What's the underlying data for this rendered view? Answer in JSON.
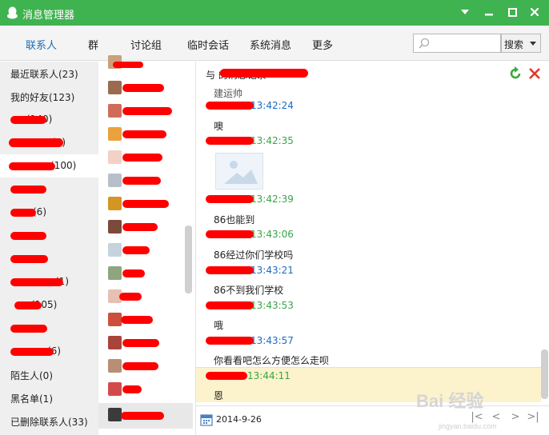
{
  "titlebar": {
    "title": "消息管理器"
  },
  "tabs": [
    {
      "label": "联系人",
      "active": true
    },
    {
      "label": "群"
    },
    {
      "label": "讨论组"
    },
    {
      "label": "临时会话"
    },
    {
      "label": "系统消息"
    },
    {
      "label": "更多"
    }
  ],
  "search": {
    "placeholder": "",
    "button_label": "搜索"
  },
  "categories": [
    {
      "label": "最近联系人(23)"
    },
    {
      "label": "我的好友(123)"
    },
    {
      "label": "(140)"
    },
    {
      "label": "(5)"
    },
    {
      "label": "(100)",
      "selected": true
    },
    {
      "label": ""
    },
    {
      "label": "(6)"
    },
    {
      "label": ""
    },
    {
      "label": ""
    },
    {
      "label": "(1)"
    },
    {
      "label": "(105)"
    },
    {
      "label": ""
    },
    {
      "label": "(6)"
    },
    {
      "label": "陌生人(0)"
    },
    {
      "label": "黑名单(1)"
    },
    {
      "label": "已删除联系人(33)"
    }
  ],
  "contacts": [
    {
      "name": ""
    },
    {
      "name": ""
    },
    {
      "name": ""
    },
    {
      "name": ""
    },
    {
      "name": ""
    },
    {
      "name": ""
    },
    {
      "name": ""
    },
    {
      "name": ""
    },
    {
      "name": ""
    },
    {
      "name": ""
    },
    {
      "name": ""
    },
    {
      "name": ""
    },
    {
      "name": ""
    },
    {
      "name": ""
    },
    {
      "name": ""
    },
    {
      "name": ""
    },
    {
      "name": ""
    },
    {
      "name": "",
      "selected": true
    }
  ],
  "messages": {
    "header": "与                                     的消息记录",
    "items": [
      {
        "text": "建运帅"
      },
      {
        "time": "13:42:24",
        "color": "blue"
      },
      {
        "text": "噢"
      },
      {
        "time": "13:42:35",
        "color": "green"
      },
      {
        "image": true
      },
      {
        "time": "13:42:39",
        "color": "green"
      },
      {
        "text": "86也能到"
      },
      {
        "time": "13:43:06",
        "color": "green"
      },
      {
        "text": "86经过你们学校吗"
      },
      {
        "time": "13:43:21",
        "color": "blue"
      },
      {
        "text": "86不到我们学校"
      },
      {
        "time": "13:43:53",
        "color": "green"
      },
      {
        "text": "哦"
      },
      {
        "time": "13:43:57",
        "color": "blue"
      },
      {
        "text": "你看看吧怎么方便怎么走呗"
      },
      {
        "time": "13:44:11",
        "color": "green"
      },
      {
        "text": "恩"
      }
    ]
  },
  "footer": {
    "date": "2014-9-26"
  },
  "watermark": {
    "brand": "Bai 经验",
    "url": "jingyan.baidu.com"
  },
  "colors": {
    "titlebar": "#3fb34f",
    "time_blue": "#1b6cc4",
    "time_green": "#38a547",
    "redaction": "#ff0000",
    "highlight": "#fcf2cc"
  }
}
